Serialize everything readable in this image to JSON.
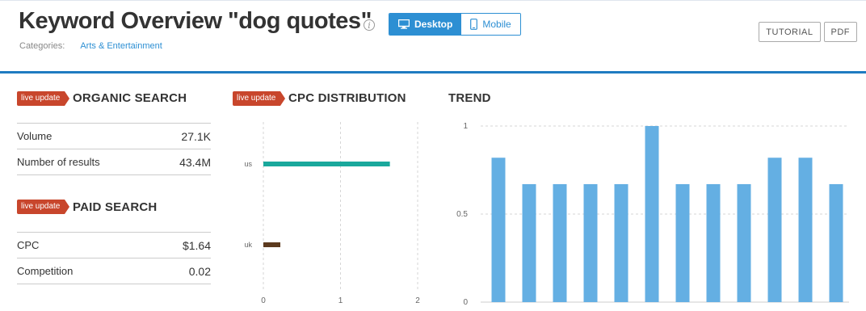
{
  "header": {
    "title": "Keyword Overview \"dog quotes\"",
    "categories_label": "Categories:",
    "categories_value": "Arts & Entertainment",
    "device_desktop": "Desktop",
    "device_mobile": "Mobile",
    "tutorial": "TUTORIAL",
    "pdf": "PDF"
  },
  "badge": "live update",
  "organic": {
    "title": "ORGANIC SEARCH",
    "rows": [
      {
        "label": "Volume",
        "value": "27.1K"
      },
      {
        "label": "Number of results",
        "value": "43.4M"
      }
    ]
  },
  "paid": {
    "title": "PAID SEARCH",
    "rows": [
      {
        "label": "CPC",
        "value": "$1.64"
      },
      {
        "label": "Competition",
        "value": "0.02"
      }
    ]
  },
  "colors": {
    "accent": "#2d8fd3",
    "badge": "#c8462c",
    "teal": "#1aa89c",
    "brown": "#5c3a1e",
    "trend_bar": "#64afe3"
  },
  "chart_data": [
    {
      "type": "bar",
      "title": "CPC DISTRIBUTION",
      "orientation": "horizontal",
      "categories": [
        "us",
        "uk"
      ],
      "values": [
        1.64,
        0.22
      ],
      "colors": [
        "#1aa89c",
        "#5c3a1e"
      ],
      "xlim": [
        0,
        2
      ],
      "xticks": [
        "0",
        "1",
        "2"
      ],
      "grid": true
    },
    {
      "type": "bar",
      "title": "TREND",
      "values": [
        0.82,
        0.67,
        0.67,
        0.67,
        0.67,
        1.0,
        0.67,
        0.67,
        0.67,
        0.82,
        0.82,
        0.67
      ],
      "ylim": [
        0,
        1
      ],
      "yticks": [
        "0",
        "0.5",
        "1"
      ],
      "grid": true
    }
  ]
}
